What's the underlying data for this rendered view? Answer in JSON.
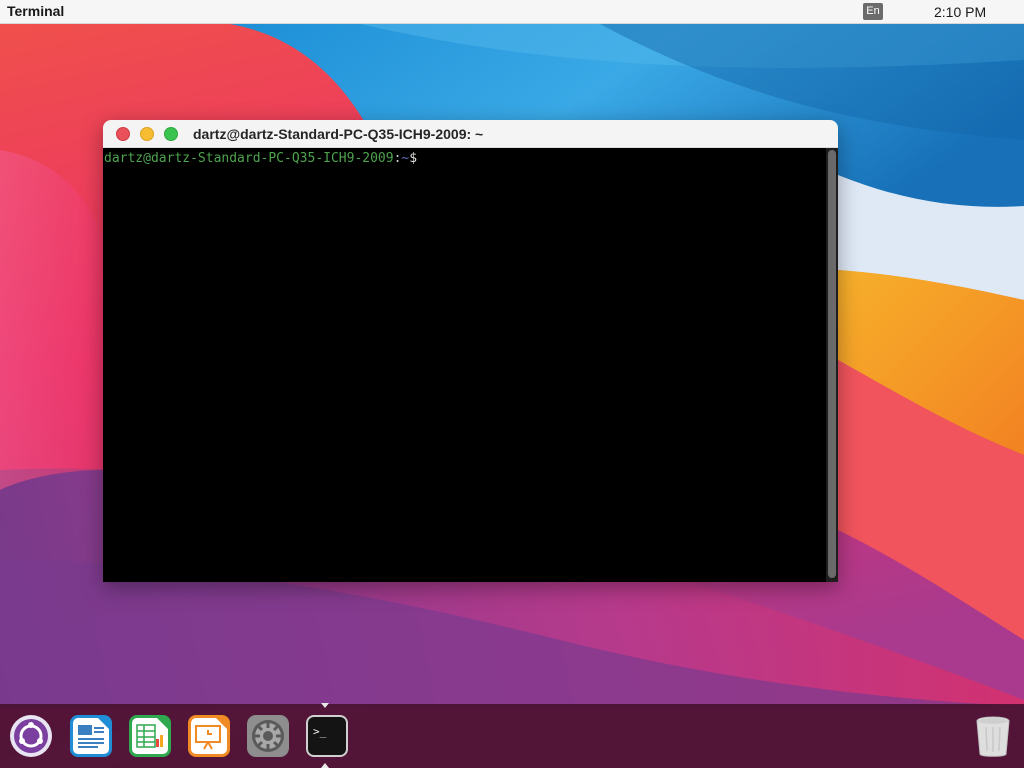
{
  "topbar": {
    "app_name": "Terminal",
    "input_language": "En",
    "clock": "2:10 PM"
  },
  "terminal": {
    "window_title": "dartz@dartz-Standard-PC-Q35-ICH9-2009: ~",
    "prompt": {
      "user_host": "dartz@dartz-Standard-PC-Q35-ICH9-2009",
      "separator": ":",
      "path": "~",
      "symbol": "$"
    }
  },
  "dock": {
    "items": [
      "launcher-icon",
      "writer-icon",
      "calc-icon",
      "impress-icon",
      "settings-icon",
      "terminal-icon"
    ],
    "trash": "trash-icon",
    "terminal_glyph": ">_"
  },
  "colors": {
    "prompt_user": "#4ea34e",
    "prompt_path": "#5b6fbd",
    "close": "#e9505a",
    "minimize": "#f6bd32",
    "maximize": "#3ac44f",
    "dock_bg": "#46102c"
  }
}
